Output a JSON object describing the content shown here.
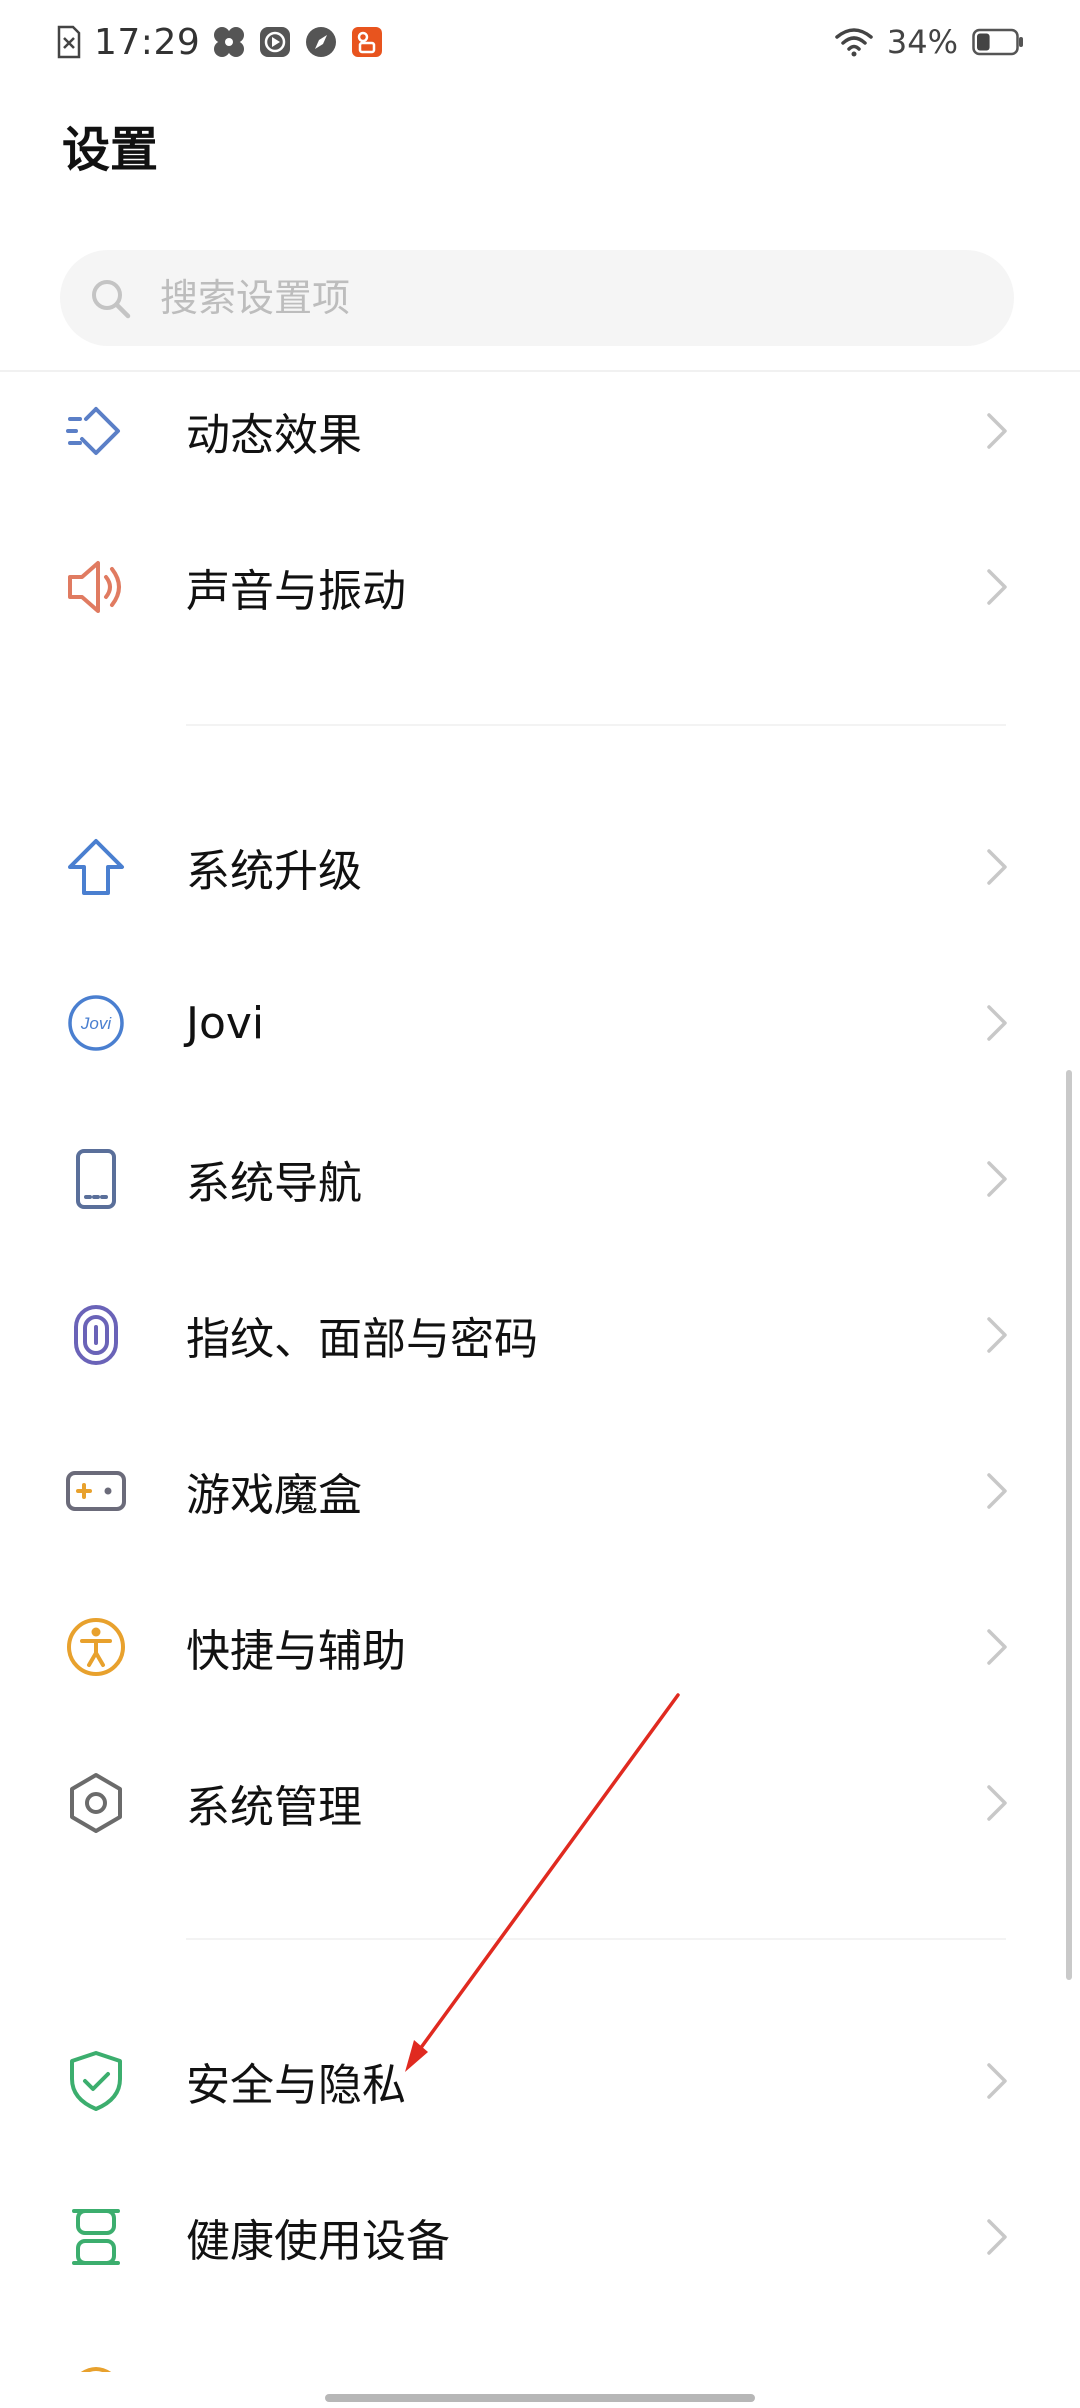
{
  "status_bar": {
    "time": "17:29",
    "battery_percent": "34%",
    "battery_level": 0.34,
    "icons": [
      "sim-card-error-icon",
      "pinwheel-icon",
      "media-play-icon",
      "compass-icon",
      "photo-app-icon",
      "wifi-icon",
      "battery-icon"
    ]
  },
  "header": {
    "title": "设置"
  },
  "search": {
    "placeholder": "搜索设置项",
    "value": ""
  },
  "settings": {
    "items": [
      {
        "label": "动态效果",
        "icon": "dynamic-effect-icon",
        "color": "#5b7fc7"
      },
      {
        "label": "声音与振动",
        "icon": "speaker-icon",
        "color": "#e07b61"
      },
      {
        "label": "系统升级",
        "icon": "upgrade-arrow-icon",
        "color": "#4a7fd0"
      },
      {
        "label": "Jovi",
        "icon": "jovi-icon",
        "color": "#4a7fd0"
      },
      {
        "label": "系统导航",
        "icon": "phone-navigation-icon",
        "color": "#5a6f9a"
      },
      {
        "label": "指纹、面部与密码",
        "icon": "fingerprint-icon",
        "color": "#6a63b8"
      },
      {
        "label": "游戏魔盒",
        "icon": "game-box-icon",
        "color": "#6b6b7a"
      },
      {
        "label": "快捷与辅助",
        "icon": "accessibility-icon",
        "color": "#e8a12d"
      },
      {
        "label": "系统管理",
        "icon": "system-gear-icon",
        "color": "#6b6b6b"
      },
      {
        "label": "安全与隐私",
        "icon": "shield-check-icon",
        "color": "#3cae6e"
      },
      {
        "label": "健康使用设备",
        "icon": "hourglass-icon",
        "color": "#3cae6e"
      }
    ]
  },
  "annotation": {
    "color": "#e02a20"
  }
}
